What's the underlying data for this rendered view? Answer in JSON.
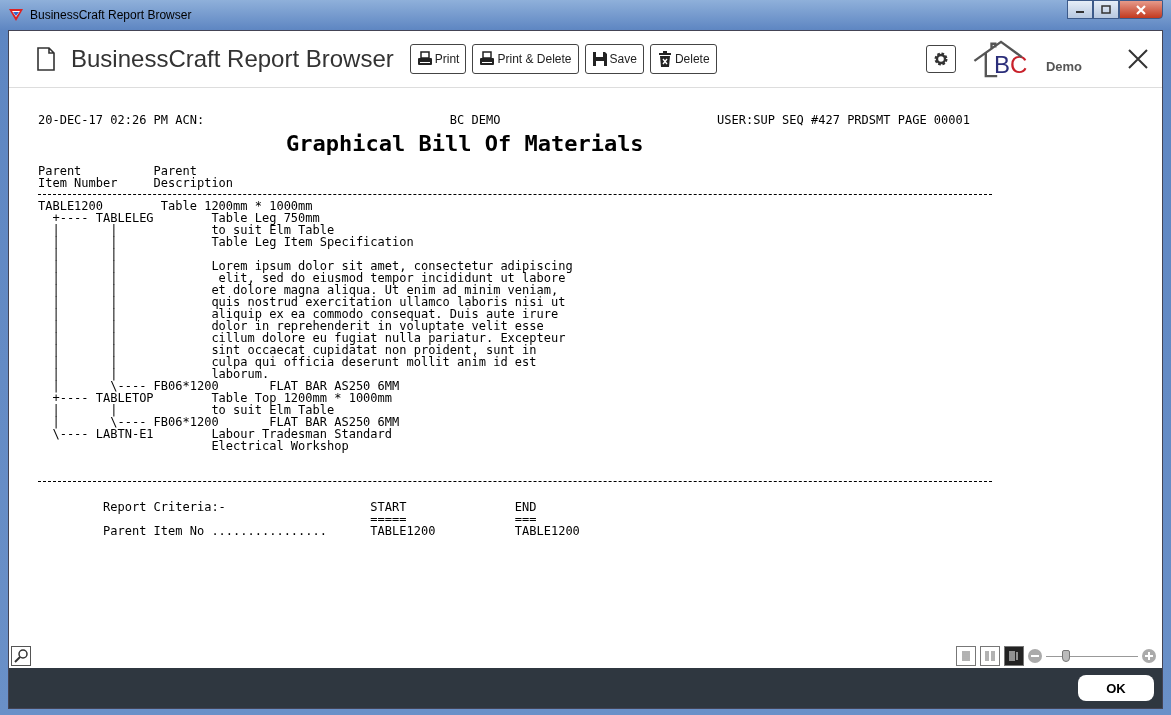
{
  "window": {
    "title": "BusinessCraft Report Browser"
  },
  "header": {
    "title": "BusinessCraft Report Browser",
    "buttons": [
      {
        "kind": "print",
        "label": "Print"
      },
      {
        "kind": "print",
        "label": "Print & Delete"
      },
      {
        "kind": "save",
        "label": "Save"
      },
      {
        "kind": "delete",
        "label": "Delete"
      }
    ],
    "logo_letters": [
      "B",
      "C"
    ],
    "company": "Demo"
  },
  "report": {
    "header_left": "20-DEC-17 02:26 PM ACN:",
    "header_center": "BC DEMO",
    "header_right": "USER:SUP SEQ #427 PRDSMT PAGE 00001",
    "title": "Graphical Bill Of Materials",
    "column_lines": [
      "Parent          Parent",
      "Item Number     Description"
    ],
    "lines": [
      "TABLE1200        Table 1200mm * 1000mm",
      "  +---- TABLELEG        Table Leg 750mm",
      "  |       |             to suit Elm Table",
      "  |       |             Table Leg Item Specification",
      "  |       |",
      "  |       |             Lorem ipsum dolor sit amet, consectetur adipiscing",
      "  |       |              elit, sed do eiusmod tempor incididunt ut labore",
      "  |       |             et dolore magna aliqua. Ut enim ad minim veniam,",
      "  |       |             quis nostrud exercitation ullamco laboris nisi ut",
      "  |       |             aliquip ex ea commodo consequat. Duis aute irure",
      "  |       |             dolor in reprehenderit in voluptate velit esse",
      "  |       |             cillum dolore eu fugiat nulla pariatur. Excepteur",
      "  |       |             sint occaecat cupidatat non proident, sunt in",
      "  |       |             culpa qui officia deserunt mollit anim id est",
      "  |       |             laborum.",
      "  |       \\---- FB06*1200       FLAT BAR AS250 6MM",
      "  +---- TABLETOP        Table Top 1200mm * 1000mm",
      "  |       |             to suit Elm Table",
      "  |       \\---- FB06*1200       FLAT BAR AS250 6MM",
      "  \\---- LABTN-E1        Labour Tradesman Standard",
      "                        Electrical Workshop"
    ],
    "criteria_lines": [
      "         Report Criteria:-                    START               END",
      "                                              =====               ===",
      "         Parent Item No ................      TABLE1200           TABLE1200"
    ]
  },
  "footer": {
    "ok": "OK",
    "view_modes": [
      {
        "selected": false
      },
      {
        "selected": false
      },
      {
        "selected": true
      }
    ],
    "zoom": {
      "level": 0.22
    }
  }
}
